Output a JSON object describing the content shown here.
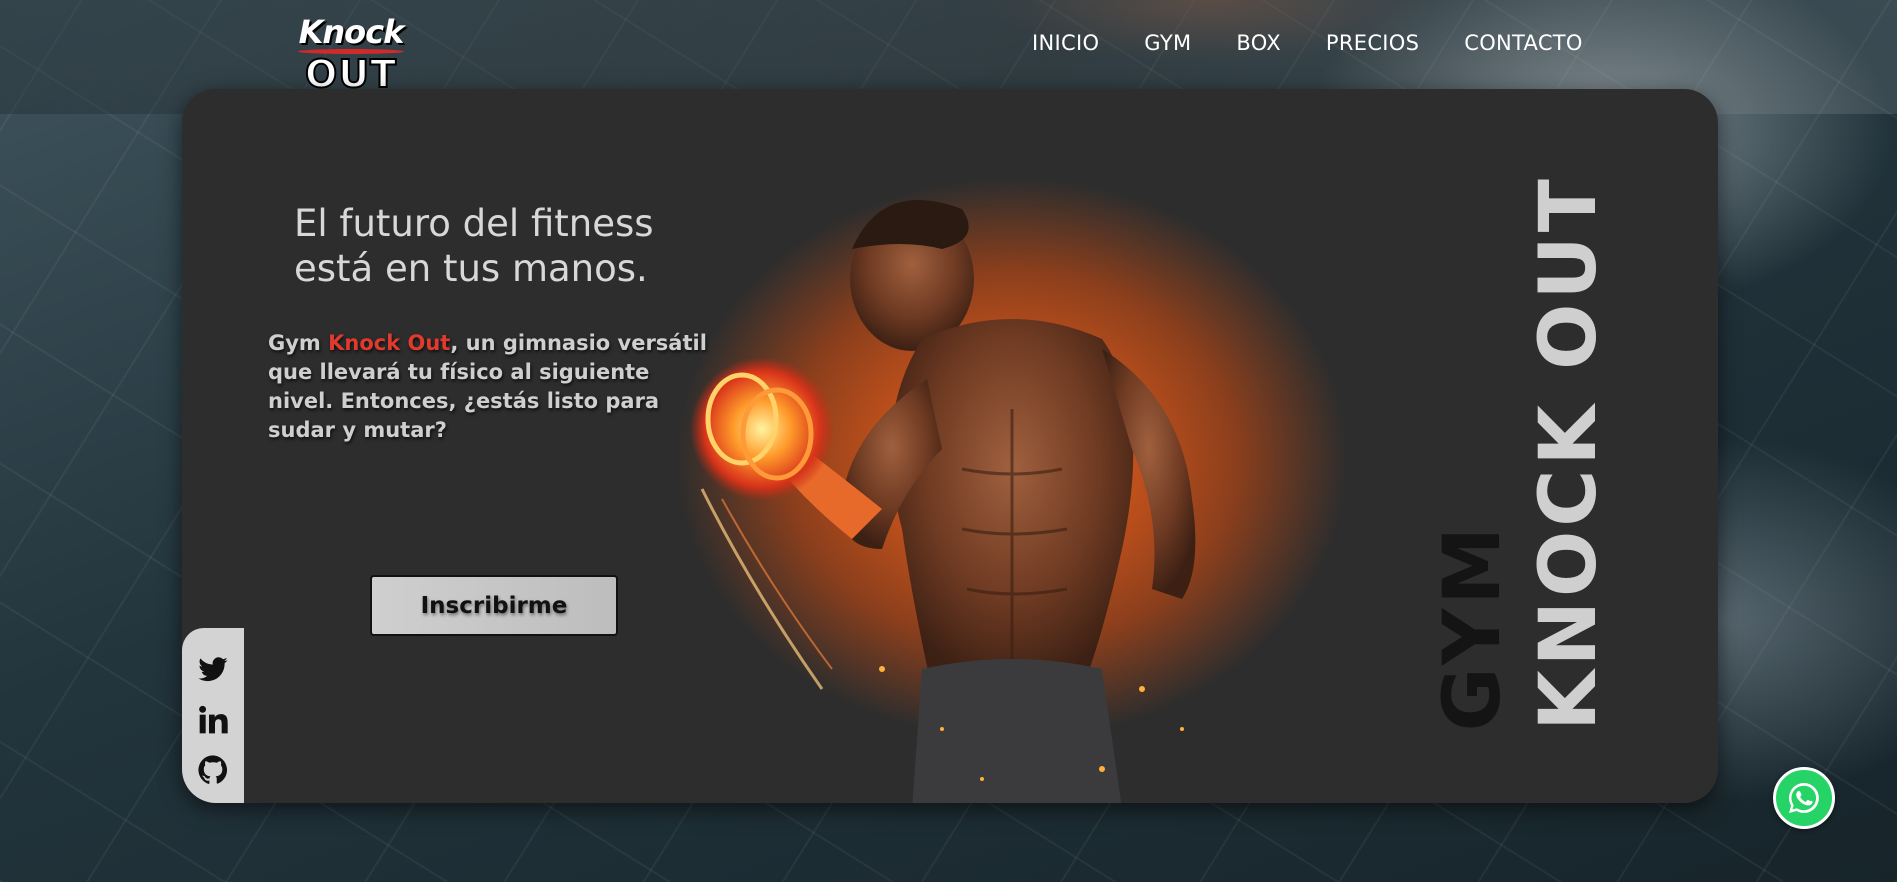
{
  "brand": {
    "logo_top": "Knock",
    "logo_bottom": "OUT"
  },
  "nav": {
    "items": [
      {
        "label": "INICIO"
      },
      {
        "label": "GYM"
      },
      {
        "label": "BOX"
      },
      {
        "label": "PRECIOS"
      },
      {
        "label": "CONTACTO"
      }
    ]
  },
  "hero": {
    "title_line1": "El futuro del fitness",
    "title_line2": "está en tus manos.",
    "desc_prefix": "Gym ",
    "desc_accent": "Knock Out",
    "desc_rest": ", un gimnasio versátil que llevará tu físico al siguiente nivel. Entonces, ¿estás listo para sudar y mutar?",
    "cta_label": "Inscribirme",
    "vertical_word1": "GYM",
    "vertical_word2": "KNOCK OUT"
  },
  "social": [
    {
      "icon": "twitter-icon"
    },
    {
      "icon": "linkedin-icon"
    },
    {
      "icon": "github-icon"
    }
  ],
  "floating": {
    "icon": "whatsapp-icon"
  },
  "colors": {
    "card_bg": "#2d2d2d",
    "accent_red": "#e03a2e",
    "glow_orange": "#e0641f",
    "whatsapp_green": "#25d366"
  }
}
